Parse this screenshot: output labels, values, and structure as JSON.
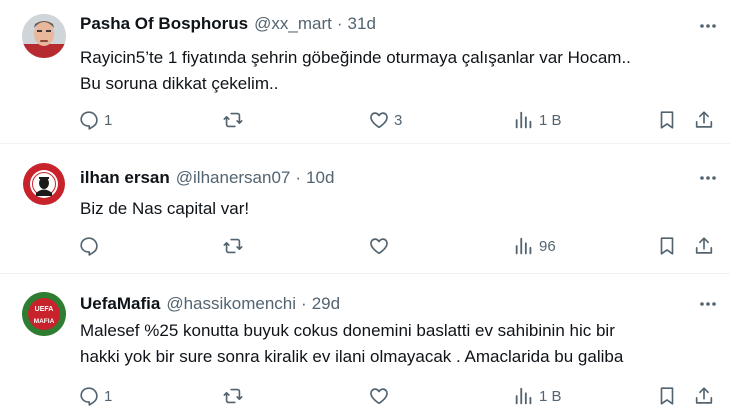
{
  "tweets": [
    {
      "name": "Pasha Of Bosphorus",
      "handle": "@xx_mart",
      "separator": "·",
      "time": "31d",
      "text_lines": [
        "Rayicin5’te 1 fiyatında şehrin göbeğinde oturmaya çalışanlar var Hocam..",
        "Bu soruna dikkat çekelim.."
      ],
      "replies": "1",
      "retweets": "",
      "likes": "3",
      "views": "1 B"
    },
    {
      "name": "ilhan ersan",
      "handle": "@ilhanersan07",
      "separator": "·",
      "time": "10d",
      "text_lines": [
        "Biz de Nas capital var!"
      ],
      "replies": "",
      "retweets": "",
      "likes": "",
      "views": "96"
    },
    {
      "name": "UefaMafia",
      "handle": "@hassikomenchi",
      "separator": "·",
      "time": "29d",
      "text_lines": [
        "Malesef %25 konutta buyuk cokus donemini baslatti ev sahibinin hic bir",
        "hakki yok bir sure sonra kiralik ev ilani olmayacak . Amaclarida bu galiba"
      ],
      "replies": "1",
      "retweets": "",
      "likes": "",
      "views": "1 B"
    }
  ],
  "avatar_logos": {
    "uefa_mafia_top": "UEFA",
    "uefa_mafia_bottom": "MAFIA"
  },
  "colors": {
    "text": "#0f1419",
    "secondary": "#536471",
    "divider": "#eff3f4",
    "mafia_red": "#c8232c",
    "mafia_green": "#2e7d32"
  },
  "icons": {
    "reply": "reply-icon",
    "retweet": "retweet-icon",
    "like": "heart-icon",
    "views": "views-icon",
    "bookmark": "bookmark-icon",
    "share": "share-icon",
    "more": "more-icon"
  }
}
